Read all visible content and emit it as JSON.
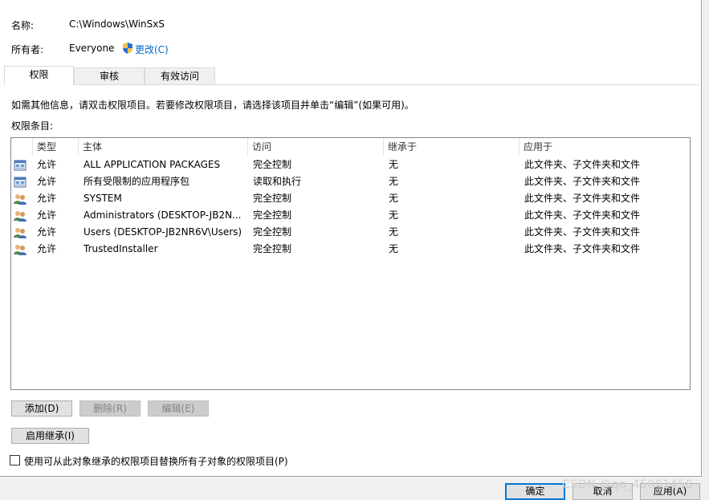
{
  "header": {
    "name_label": "名称:",
    "name_value": "C:\\Windows\\WinSxS",
    "owner_label": "所有者:",
    "owner_value": "Everyone",
    "change_link": "更改(C)"
  },
  "tabs": [
    {
      "label": "权限",
      "active": true
    },
    {
      "label": "审核",
      "active": false
    },
    {
      "label": "有效访问",
      "active": false
    }
  ],
  "info_text": "如需其他信息，请双击权限项目。若要修改权限项目，请选择该项目并单击“编辑”(如果可用)。",
  "entries_label": "权限条目:",
  "table": {
    "columns": [
      "类型",
      "主体",
      "访问",
      "继承于",
      "应用于"
    ],
    "rows": [
      {
        "icon": "package-icon",
        "type": "允许",
        "principal": "ALL APPLICATION PACKAGES",
        "access": "完全控制",
        "inherited": "无",
        "applies": "此文件夹、子文件夹和文件"
      },
      {
        "icon": "package-icon",
        "type": "允许",
        "principal": "所有受限制的应用程序包",
        "access": "读取和执行",
        "inherited": "无",
        "applies": "此文件夹、子文件夹和文件"
      },
      {
        "icon": "users-icon",
        "type": "允许",
        "principal": "SYSTEM",
        "access": "完全控制",
        "inherited": "无",
        "applies": "此文件夹、子文件夹和文件"
      },
      {
        "icon": "users-icon",
        "type": "允许",
        "principal": "Administrators (DESKTOP-JB2N...",
        "access": "完全控制",
        "inherited": "无",
        "applies": "此文件夹、子文件夹和文件"
      },
      {
        "icon": "users-icon",
        "type": "允许",
        "principal": "Users (DESKTOP-JB2NR6V\\Users)",
        "access": "完全控制",
        "inherited": "无",
        "applies": "此文件夹、子文件夹和文件"
      },
      {
        "icon": "users-icon",
        "type": "允许",
        "principal": "TrustedInstaller",
        "access": "完全控制",
        "inherited": "无",
        "applies": "此文件夹、子文件夹和文件"
      }
    ]
  },
  "buttons": {
    "add": "添加(D)",
    "remove": "删除(R)",
    "edit": "编辑(E)",
    "enable_inheritance": "启用继承(I)"
  },
  "replace_checkbox": {
    "label": "使用可从此对象继承的权限项目替换所有子对象的权限项目(P)",
    "checked": false
  },
  "footer": {
    "ok": "确定",
    "cancel": "取消",
    "apply": "应用(A)"
  },
  "watermark": "CSDN @qq_45061458"
}
